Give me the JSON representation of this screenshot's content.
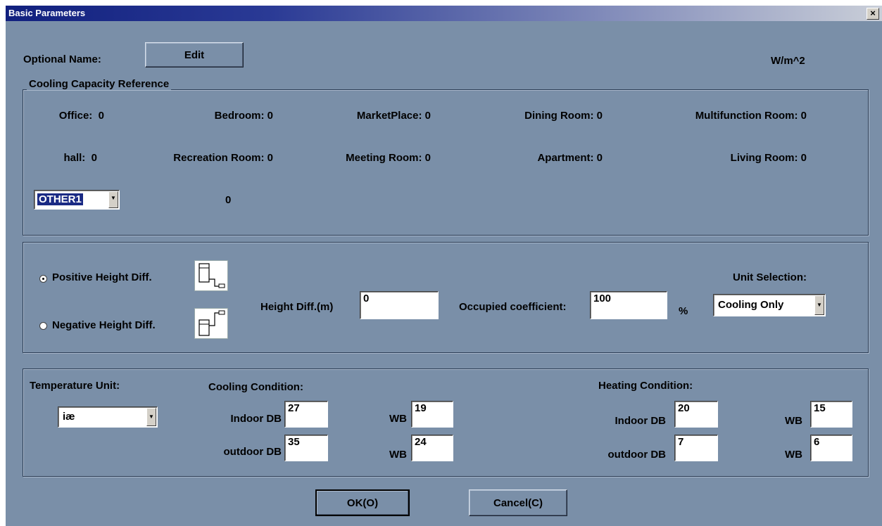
{
  "window": {
    "title": "Basic Parameters",
    "close_icon": "x-icon"
  },
  "optional_name": {
    "label": "Optional Name:",
    "button": "Edit"
  },
  "unit_note": "W/m^2",
  "cooling_ref": {
    "caption": "Cooling Capacity Reference",
    "rooms": [
      {
        "label": "Office:",
        "value": "0"
      },
      {
        "label": "Bedroom:",
        "value": "0"
      },
      {
        "label": "MarketPlace:",
        "value": "0"
      },
      {
        "label": "Dining Room:",
        "value": "0"
      },
      {
        "label": "Multifunction Room:",
        "value": "0"
      },
      {
        "label": "hall:",
        "value": "0"
      },
      {
        "label": "Recreation Room:",
        "value": "0"
      },
      {
        "label": "Meeting Room:",
        "value": "0"
      },
      {
        "label": "Apartment:",
        "value": "0"
      },
      {
        "label": "Living Room:",
        "value": "0"
      }
    ],
    "other_select": "OTHER1",
    "other_value": "0"
  },
  "height": {
    "positive_label": "Positive Height Diff.",
    "negative_label": "Negative Height Diff.",
    "selected": "positive",
    "diff_label": "Height Diff.(m)",
    "diff_value": "0",
    "occupied_label": "Occupied coefficient:",
    "occupied_value": "100",
    "percent": "%",
    "unit_selection_label": "Unit Selection:",
    "unit_selection_value": "Cooling Only"
  },
  "temperature": {
    "unit_label": "Temperature Unit:",
    "unit_value": "iæ",
    "cooling": {
      "caption": "Cooling Condition:",
      "indoor_label": "Indoor DB",
      "indoor_db": "27",
      "indoor_wb_label": "WB",
      "indoor_wb": "19",
      "outdoor_label": "outdoor DB",
      "outdoor_db": "35",
      "outdoor_wb_label": "WB",
      "outdoor_wb": "24"
    },
    "heating": {
      "caption": "Heating Condition:",
      "indoor_label": "Indoor DB",
      "indoor_db": "20",
      "indoor_wb_label": "WB",
      "indoor_wb": "15",
      "outdoor_label": "outdoor DB",
      "outdoor_db": "7",
      "outdoor_wb_label": "WB",
      "outdoor_wb": "6"
    }
  },
  "buttons": {
    "ok": "OK(O)",
    "cancel": "Cancel(C)"
  }
}
